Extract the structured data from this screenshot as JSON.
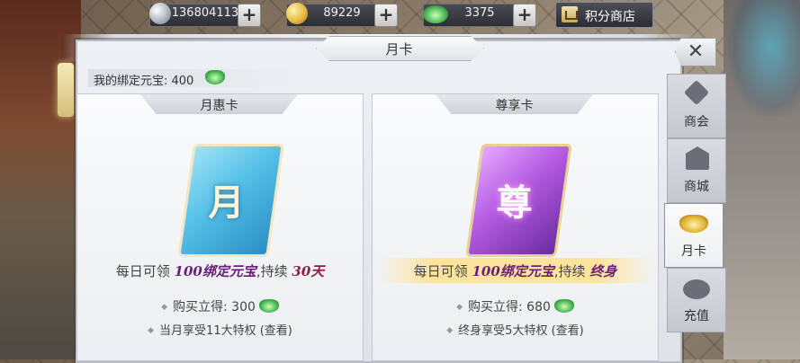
{
  "resources": [
    {
      "value": "136804113",
      "icon": "silver-coin-icon"
    },
    {
      "value": "89229",
      "icon": "gold-coin-icon"
    },
    {
      "value": "3375",
      "icon": "bound-ingot-icon"
    }
  ],
  "shop": {
    "label": "积分商店"
  },
  "window": {
    "title": "月卡",
    "close": "✕"
  },
  "bound_ingot": {
    "label": "我的绑定元宝: 400"
  },
  "cards": [
    {
      "header": "月惠卡",
      "art_char": "月",
      "desc_prefix": "每日可领",
      "desc_amount": "100绑定元宝",
      "desc_mid": ",持续",
      "desc_duration": "30天",
      "price": "购买立得: 300",
      "privilege": "当月享受11大特权 (查看)"
    },
    {
      "header": "尊享卡",
      "art_char": "尊",
      "desc_prefix": "每日可领",
      "desc_amount": "100绑定元宝",
      "desc_mid": ",持续",
      "desc_duration": "终身",
      "price": "购买立得: 680",
      "privilege": "终身享受5大特权 (查看)"
    }
  ],
  "tabs": [
    {
      "label": "商会",
      "icon": "guild-icon",
      "active": false
    },
    {
      "label": "商城",
      "icon": "store-icon",
      "active": false
    },
    {
      "label": "月卡",
      "icon": "ingot-icon",
      "active": true
    },
    {
      "label": "充值",
      "icon": "recharge-icon",
      "active": false
    }
  ]
}
